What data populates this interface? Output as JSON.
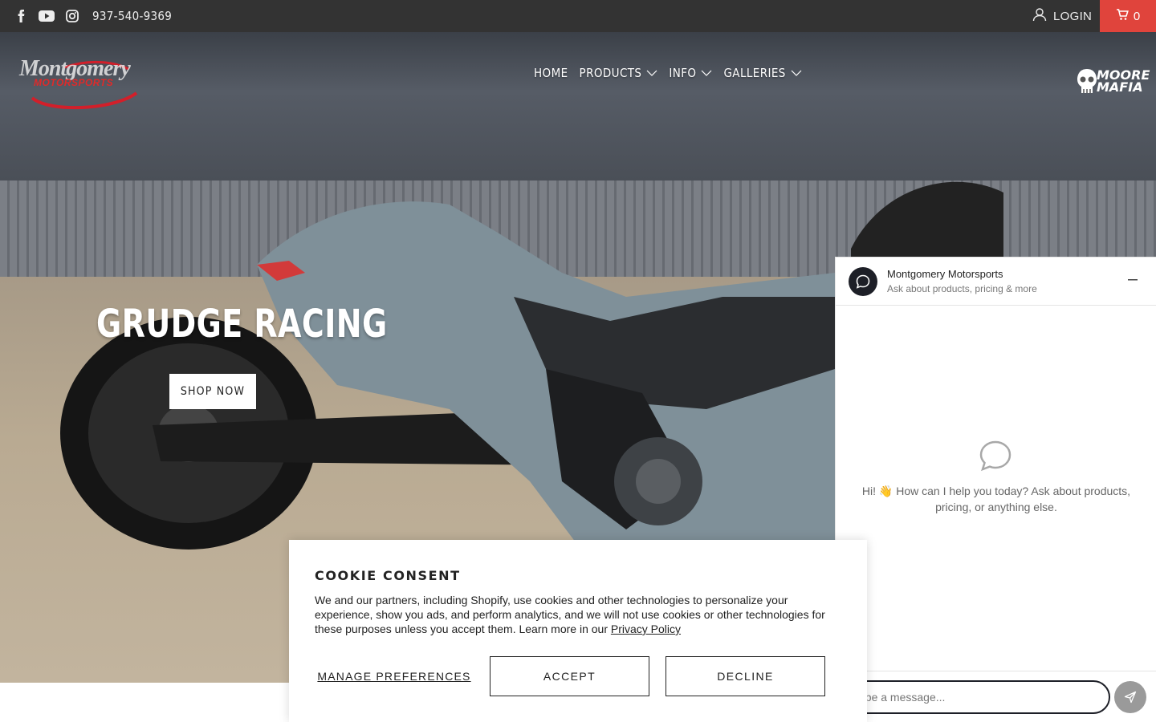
{
  "topbar": {
    "social": [
      "facebook-icon",
      "youtube-icon",
      "instagram-icon"
    ],
    "phone": "937-540-9369",
    "login_label": "LOGIN",
    "cart_count": "0"
  },
  "header": {
    "logo_line1": "Montgomery",
    "logo_line2": "MOTORSPORTS",
    "nav": [
      {
        "label": "HOME",
        "dropdown": false
      },
      {
        "label": "PRODUCTS",
        "dropdown": true
      },
      {
        "label": "INFO",
        "dropdown": true
      },
      {
        "label": "GALLERIES",
        "dropdown": true
      }
    ],
    "partner_logo_text": "MOORE MAFIA"
  },
  "hero": {
    "title": "GRUDGE RACING",
    "button": "SHOP NOW"
  },
  "chat": {
    "name": "Montgomery Motorsports",
    "subtitle": "Ask about products, pricing & more",
    "welcome": "Hi! 👋 How can I help you today? Ask about products, pricing, or anything else.",
    "input_placeholder": "Type a message..."
  },
  "cookie": {
    "title": "COOKIE CONSENT",
    "text": "We and our partners, including Shopify, use cookies and other technologies to personalize your experience, show you ads, and perform analytics, and we will not use cookies or other technologies for these purposes unless you accept them. Learn more in our ",
    "link": "Privacy Policy",
    "manage": "MANAGE PREFERENCES",
    "accept": "ACCEPT",
    "decline": "DECLINE"
  },
  "colors": {
    "topbar_bg": "#333333",
    "cart_bg": "#e0443c",
    "chat_accent": "#1d1f27"
  }
}
